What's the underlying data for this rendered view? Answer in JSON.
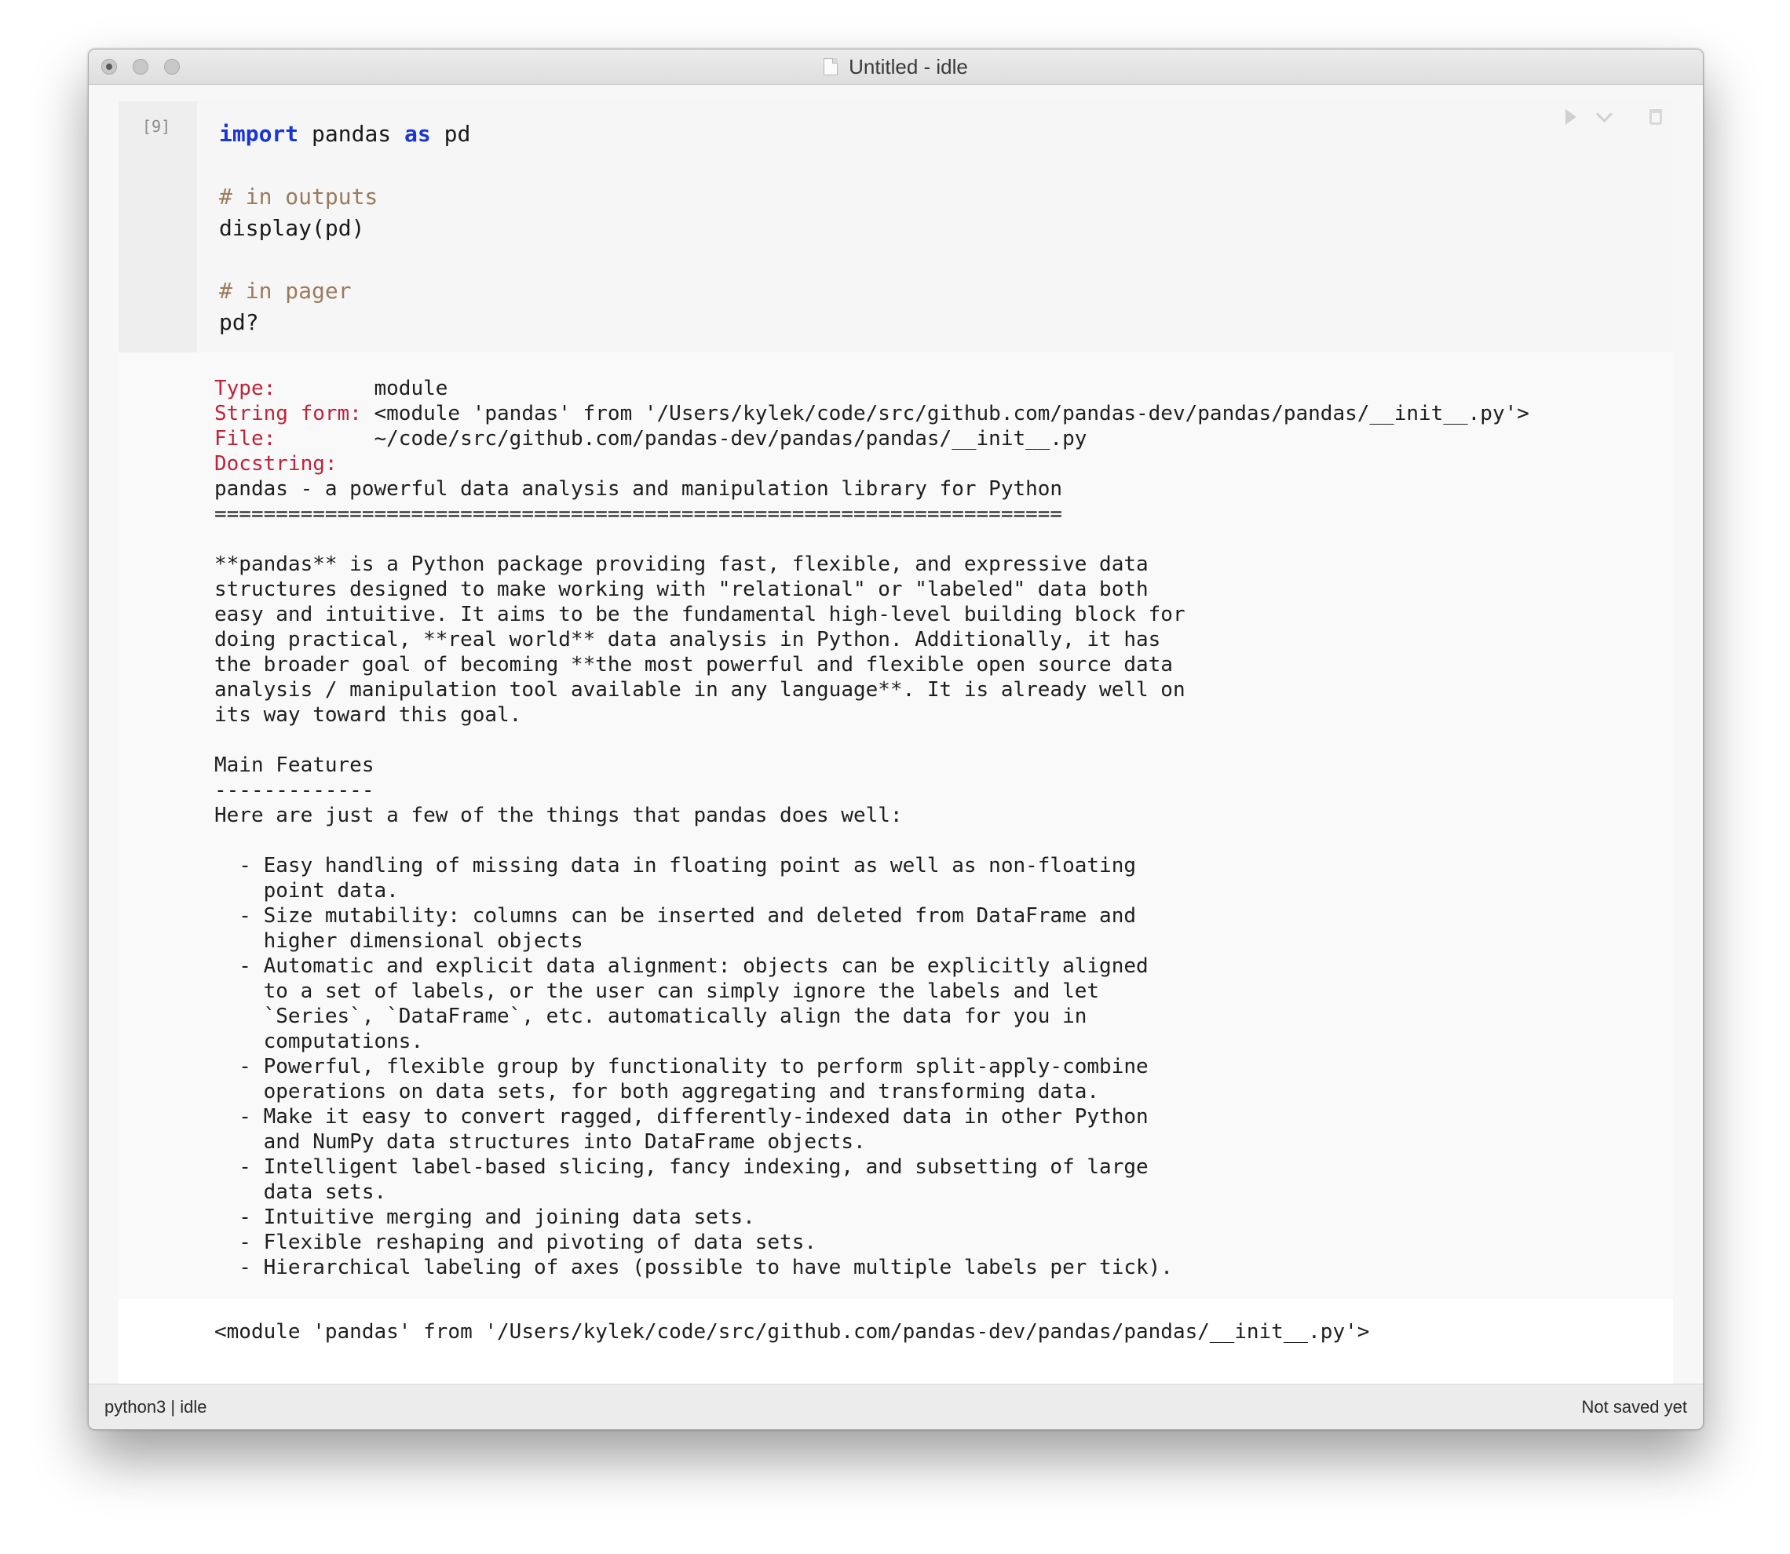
{
  "window": {
    "title": "Untitled - idle"
  },
  "cell": {
    "prompt": "[9]",
    "code_lines": [
      [
        {
          "t": "import",
          "c": "kw"
        },
        {
          "t": " pandas ",
          "c": ""
        },
        {
          "t": "as",
          "c": "kw"
        },
        {
          "t": " pd",
          "c": ""
        }
      ],
      [],
      [
        {
          "t": "# in outputs",
          "c": "cm"
        }
      ],
      [
        {
          "t": "display(pd)",
          "c": ""
        }
      ],
      [],
      [
        {
          "t": "# in pager",
          "c": "cm"
        }
      ],
      [
        {
          "t": "pd?",
          "c": ""
        }
      ]
    ]
  },
  "pager": {
    "lines": [
      [
        {
          "t": "Type:       ",
          "c": "red"
        },
        {
          "t": " module",
          "c": ""
        }
      ],
      [
        {
          "t": "String form:",
          "c": "red"
        },
        {
          "t": " <module 'pandas' from '/Users/kylek/code/src/github.com/pandas-dev/pandas/pandas/__init__.py'>",
          "c": ""
        }
      ],
      [
        {
          "t": "File:       ",
          "c": "red"
        },
        {
          "t": " ~/code/src/github.com/pandas-dev/pandas/pandas/__init__.py",
          "c": ""
        }
      ],
      [
        {
          "t": "Docstring:",
          "c": "red"
        }
      ],
      [
        {
          "t": "pandas - a powerful data analysis and manipulation library for Python",
          "c": ""
        }
      ],
      [
        {
          "t": "=====================================================================",
          "c": ""
        }
      ],
      [],
      [
        {
          "t": "**pandas** is a Python package providing fast, flexible, and expressive data",
          "c": ""
        }
      ],
      [
        {
          "t": "structures designed to make working with \"relational\" or \"labeled\" data both",
          "c": ""
        }
      ],
      [
        {
          "t": "easy and intuitive. It aims to be the fundamental high-level building block for",
          "c": ""
        }
      ],
      [
        {
          "t": "doing practical, **real world** data analysis in Python. Additionally, it has",
          "c": ""
        }
      ],
      [
        {
          "t": "the broader goal of becoming **the most powerful and flexible open source data",
          "c": ""
        }
      ],
      [
        {
          "t": "analysis / manipulation tool available in any language**. It is already well on",
          "c": ""
        }
      ],
      [
        {
          "t": "its way toward this goal.",
          "c": ""
        }
      ],
      [],
      [
        {
          "t": "Main Features",
          "c": ""
        }
      ],
      [
        {
          "t": "-------------",
          "c": ""
        }
      ],
      [
        {
          "t": "Here are just a few of the things that pandas does well:",
          "c": ""
        }
      ],
      [],
      [
        {
          "t": "  - Easy handling of missing data in floating point as well as non-floating",
          "c": ""
        }
      ],
      [
        {
          "t": "    point data.",
          "c": ""
        }
      ],
      [
        {
          "t": "  - Size mutability: columns can be inserted and deleted from DataFrame and",
          "c": ""
        }
      ],
      [
        {
          "t": "    higher dimensional objects",
          "c": ""
        }
      ],
      [
        {
          "t": "  - Automatic and explicit data alignment: objects can be explicitly aligned",
          "c": ""
        }
      ],
      [
        {
          "t": "    to a set of labels, or the user can simply ignore the labels and let",
          "c": ""
        }
      ],
      [
        {
          "t": "    `Series`, `DataFrame`, etc. automatically align the data for you in",
          "c": ""
        }
      ],
      [
        {
          "t": "    computations.",
          "c": ""
        }
      ],
      [
        {
          "t": "  - Powerful, flexible group by functionality to perform split-apply-combine",
          "c": ""
        }
      ],
      [
        {
          "t": "    operations on data sets, for both aggregating and transforming data.",
          "c": ""
        }
      ],
      [
        {
          "t": "  - Make it easy to convert ragged, differently-indexed data in other Python",
          "c": ""
        }
      ],
      [
        {
          "t": "    and NumPy data structures into DataFrame objects.",
          "c": ""
        }
      ],
      [
        {
          "t": "  - Intelligent label-based slicing, fancy indexing, and subsetting of large",
          "c": ""
        }
      ],
      [
        {
          "t": "    data sets.",
          "c": ""
        }
      ],
      [
        {
          "t": "  - Intuitive merging and joining data sets.",
          "c": ""
        }
      ],
      [
        {
          "t": "  - Flexible reshaping and pivoting of data sets.",
          "c": ""
        }
      ],
      [
        {
          "t": "  - Hierarchical labeling of axes (possible to have multiple labels per tick).",
          "c": ""
        }
      ]
    ]
  },
  "output": {
    "text": "<module 'pandas' from '/Users/kylek/code/src/github.com/pandas-dev/pandas/pandas/__init__.py'>"
  },
  "status": {
    "left": "python3 | idle",
    "right": "Not saved yet"
  },
  "icons": {
    "run": "play-icon",
    "expand": "chevron-down-icon",
    "delete": "trash-icon",
    "document": "document-icon"
  },
  "colors": {
    "keyword": "#1a35d6",
    "comment": "#9b7b5d",
    "pager_label": "#c0223b"
  }
}
